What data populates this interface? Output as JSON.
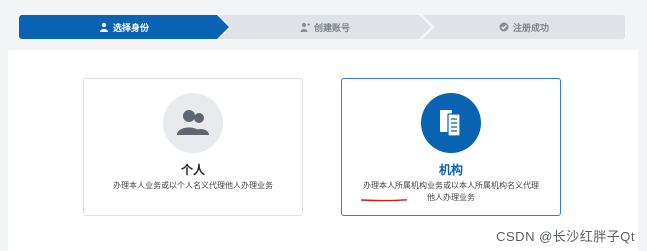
{
  "steps": [
    {
      "label": "选择身份",
      "icon": "user-icon",
      "active": true
    },
    {
      "label": "创建账号",
      "icon": "user-add-icon",
      "active": false
    },
    {
      "label": "注册成功",
      "icon": "check-circle-icon",
      "active": false
    }
  ],
  "cards": {
    "personal": {
      "title": "个人",
      "description": "办理本人业务或以个人名义代理他人办理业务",
      "icon": "users-icon"
    },
    "organization": {
      "title": "机构",
      "description": "办理本人所属机构业务或以本人所属机构名义代理他人办理业务",
      "icon": "document-icon"
    }
  },
  "watermark": "CSDN @长沙红胖子Qt",
  "colors": {
    "primary": "#0a62b3",
    "step_inactive": "#dfe3e8",
    "annotation": "#d9161b"
  }
}
